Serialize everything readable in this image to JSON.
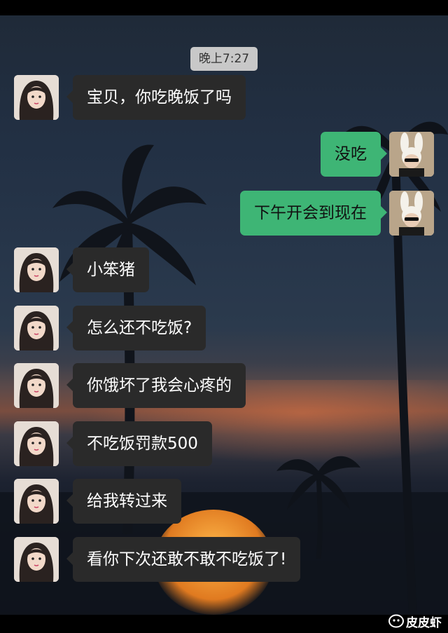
{
  "timestamp": "晚上7:27",
  "messages": [
    {
      "side": "in",
      "text": "宝贝，你吃晚饭了吗",
      "avatar": "girl-avatar"
    },
    {
      "side": "out",
      "text": "没吃",
      "avatar": "bunny-hat-avatar"
    },
    {
      "side": "out",
      "text": "下午开会到现在",
      "avatar": "bunny-hat-avatar"
    },
    {
      "side": "in",
      "text": "小笨猪",
      "avatar": "girl-avatar"
    },
    {
      "side": "in",
      "text": "怎么还不吃饭?",
      "avatar": "girl-avatar"
    },
    {
      "side": "in",
      "text": "你饿坏了我会心疼的",
      "avatar": "girl-avatar"
    },
    {
      "side": "in",
      "text": "不吃饭罚款500",
      "avatar": "girl-avatar"
    },
    {
      "side": "in",
      "text": "给我转过来",
      "avatar": "girl-avatar"
    },
    {
      "side": "in",
      "text": "看你下次还敢不敢不吃饭了!",
      "avatar": "girl-avatar"
    }
  ],
  "watermark": "皮皮虾",
  "colors": {
    "incoming_bubble": "#2a2a2a",
    "outgoing_bubble": "#3eb575",
    "time_pill": "#c8c8c8"
  }
}
